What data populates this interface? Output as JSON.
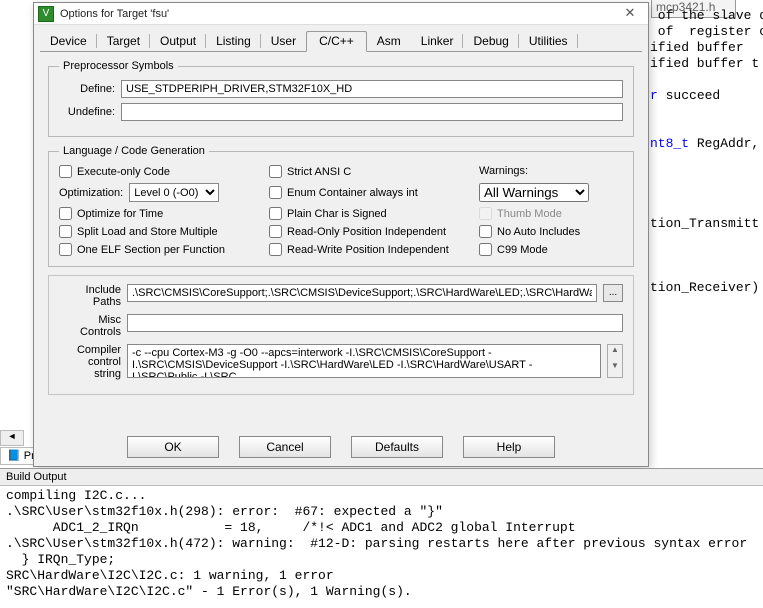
{
  "bg_file_tab": "mcp3421.h",
  "bg_code": {
    "l1": " of the slave d",
    "l2": " of  register o",
    "l3": "ified buffer",
    "l4": "ified buffer t",
    "l5": "",
    "l6_kw": "r",
    "l6": " succeed",
    "l8_type": "nt8_t",
    "l8": " RegAddr,",
    "l9": "tion_Transmitt",
    "l10": "tion_Receiver)"
  },
  "dialog": {
    "title": "Options for Target 'fsu'",
    "close_x": "✕",
    "tabs": [
      "Device",
      "Target",
      "Output",
      "Listing",
      "User",
      "C/C++",
      "Asm",
      "Linker",
      "Debug",
      "Utilities"
    ],
    "active_tab": 5,
    "preproc": {
      "legend": "Preprocessor Symbols",
      "define_lbl": "Define:",
      "define_val": "USE_STDPERIPH_DRIVER,STM32F10X_HD",
      "undef_lbl": "Undefine:",
      "undef_val": ""
    },
    "lang": {
      "legend": "Language / Code Generation",
      "exec_only": "Execute-only Code",
      "opt_lbl": "Optimization:",
      "opt_val": "Level 0 (-O0)",
      "opt_time": "Optimize for Time",
      "split_ls": "Split Load and Store Multiple",
      "one_elf": "One ELF Section per Function",
      "strict": "Strict ANSI C",
      "enum_int": "Enum Container always int",
      "plain_char": "Plain Char is Signed",
      "ro_pi": "Read-Only Position Independent",
      "rw_pi": "Read-Write Position Independent",
      "warn_lbl": "Warnings:",
      "warn_val": "All Warnings",
      "thumb": "Thumb Mode",
      "no_auto": "No Auto Includes",
      "c99": "C99 Mode"
    },
    "paths": {
      "include_lbl": "Include\nPaths",
      "include_val": ".\\SRC\\CMSIS\\CoreSupport;.\\SRC\\CMSIS\\DeviceSupport;.\\SRC\\HardWare\\LED;.\\SRC\\HardWare",
      "browse": "...",
      "misc_lbl": "Misc\nControls",
      "misc_val": "",
      "cc_lbl": "Compiler\ncontrol\nstring",
      "cc_val": "-c --cpu Cortex-M3 -g -O0 --apcs=interwork -I.\\SRC\\CMSIS\\CoreSupport -I.\\SRC\\CMSIS\\DeviceSupport -I.\\SRC\\HardWare\\LED -I.\\SRC\\HardWare\\USART -I.\\SRC\\Public -I.\\SRC"
    },
    "buttons": {
      "ok": "OK",
      "cancel": "Cancel",
      "defaults": "Defaults",
      "help": "Help"
    }
  },
  "proj_tab": "Pr",
  "build": {
    "header": "Build Output",
    "lines": [
      "compiling I2C.c...",
      ".\\SRC\\User\\stm32f10x.h(298): error:  #67: expected a \"}\"",
      "      ADC1_2_IRQn           = 18,     /*!< ADC1 and ADC2 global Interrupt",
      ".\\SRC\\User\\stm32f10x.h(472): warning:  #12-D: parsing restarts here after previous syntax error",
      "  } IRQn_Type;",
      "SRC\\HardWare\\I2C\\I2C.c: 1 warning, 1 error",
      "\"SRC\\HardWare\\I2C\\I2C.c\" - 1 Error(s), 1 Warning(s)."
    ]
  }
}
